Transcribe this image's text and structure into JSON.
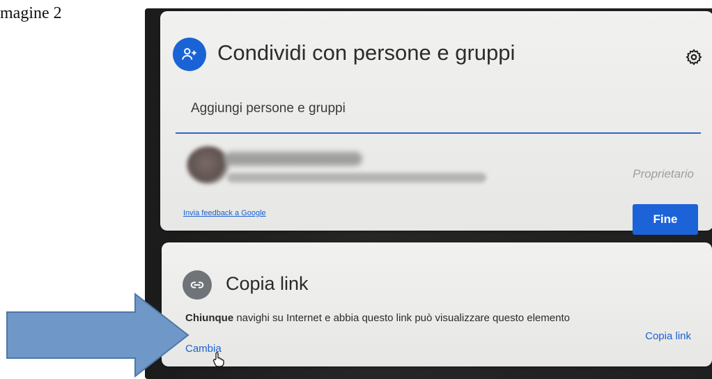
{
  "caption": "magine 2",
  "share_card": {
    "title": "Condividi con persone e gruppi",
    "add_placeholder": "Aggiungi persone e gruppi",
    "owner_role": "Proprietario",
    "feedback_link": "Invia feedback a Google",
    "done_button": "Fine"
  },
  "link_card": {
    "title": "Copia link",
    "desc_bold": "Chiunque",
    "desc_rest": " navighi su Internet e abbia questo link può visualizzare questo elemento",
    "change_link": "Cambia",
    "copy_link_button": "Copia link"
  },
  "icons": {
    "share": "add-person-icon",
    "settings": "gear-icon",
    "link": "link-icon",
    "cursor": "hand-pointer-icon"
  },
  "colors": {
    "accent": "#1d63d8",
    "arrow": "#6f98c8"
  }
}
